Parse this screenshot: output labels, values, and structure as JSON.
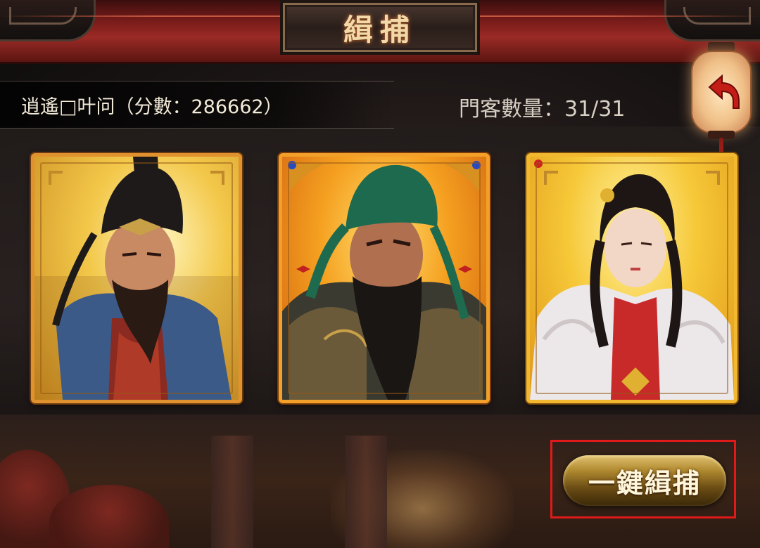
{
  "header": {
    "title": "緝捕"
  },
  "player": {
    "info": "逍遙□叶问（分數：286662）"
  },
  "retainers": {
    "count_text": "門客數量：31/31"
  },
  "cards": [
    {
      "name": "official-portrait",
      "frame_color": "#e0922e"
    },
    {
      "name": "green-hat-general-portrait",
      "frame_color": "#f2a02a"
    },
    {
      "name": "lady-portrait",
      "frame_color": "#f2b830"
    }
  ],
  "actions": {
    "arrest_all_label": "一鍵緝捕",
    "back_icon": "back-arrow-icon"
  },
  "colors": {
    "header_red": "#9a2a25",
    "title_gold": "#f3d9a8",
    "highlight_red": "#e01a1a"
  }
}
